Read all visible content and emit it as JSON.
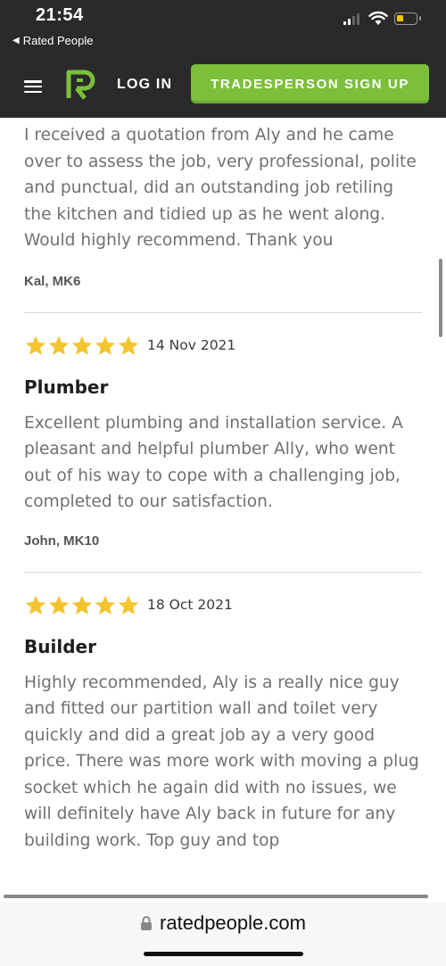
{
  "status_bar": {
    "time": "21:54",
    "back_app": "Rated People"
  },
  "header": {
    "login_label": "LOG IN",
    "signup_label": "TRADESPERSON SIGN UP",
    "brand_color": "#7bbf3a",
    "bg_color": "#2a2a2a"
  },
  "reviews": [
    {
      "text": "I received a quotation from Aly and he came over to assess the job, very professional, polite and punctual, did an outstanding job retiling the kitchen and tidied up as he went along. Would highly recommend. Thank you",
      "reviewer": "Kal, MK6"
    },
    {
      "rating": 5,
      "date": "14 Nov 2021",
      "title": "Plumber",
      "text": "Excellent plumbing and installation service. A pleasant and helpful plumber Ally, who went out of his way to cope with a challenging job, completed to our satisfaction.",
      "reviewer": "John, MK10"
    },
    {
      "rating": 5,
      "date": "18 Oct 2021",
      "title": "Builder",
      "text": "Highly recommended, Aly is a really nice guy and fitted our partition wall and toilet very quickly and did a great job ay a very good price. There was more work with moving a plug socket which he again did with no issues, we will definitely have Aly back in future for any building work. Top guy and top"
    }
  ],
  "url_bar": {
    "domain": "ratedpeople.com"
  },
  "icons": [
    "back-arrow-icon",
    "signal-icon",
    "wifi-icon",
    "battery-icon",
    "menu-icon",
    "rated-people-logo-icon",
    "star-icon",
    "lock-icon"
  ],
  "star_color": "#f4c430"
}
